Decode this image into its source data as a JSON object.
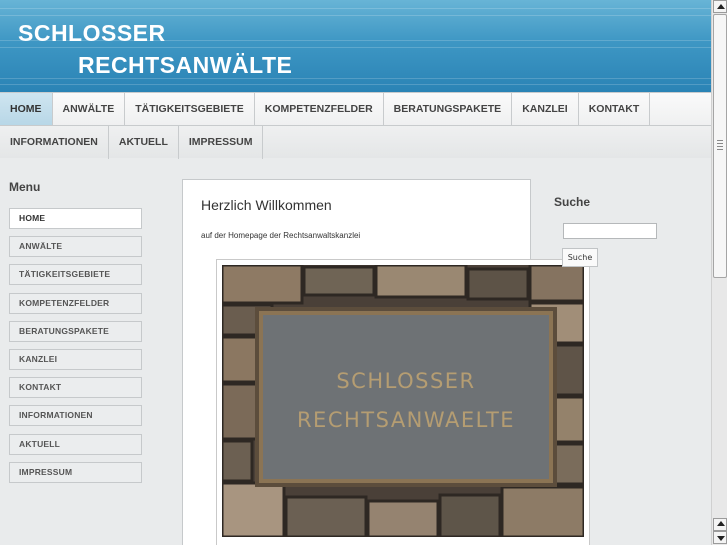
{
  "header": {
    "logo_line1": "SCHLOSSER",
    "logo_line2": "RECHTSANWÄLTE"
  },
  "nav": {
    "row1": [
      {
        "label": "HOME",
        "active": true
      },
      {
        "label": "ANWÄLTE"
      },
      {
        "label": "TÄTIGKEITSGEBIETE"
      },
      {
        "label": "KOMPETENZFELDER"
      },
      {
        "label": "BERATUNGSPAKETE"
      },
      {
        "label": "KANZLEI"
      },
      {
        "label": "KONTAKT"
      }
    ],
    "row2": [
      {
        "label": "INFORMATIONEN"
      },
      {
        "label": "AKTUELL"
      },
      {
        "label": "IMPRESSUM"
      }
    ]
  },
  "sidebar": {
    "title": "Menu",
    "items": [
      {
        "label": "HOME",
        "active": true
      },
      {
        "label": "ANWÄLTE"
      },
      {
        "label": "TÄTIGKEITSGEBIETE"
      },
      {
        "label": "KOMPETENZFELDER"
      },
      {
        "label": "BERATUNGSPAKETE"
      },
      {
        "label": "KANZLEI"
      },
      {
        "label": "KONTAKT"
      },
      {
        "label": "INFORMATIONEN"
      },
      {
        "label": "AKTUELL"
      },
      {
        "label": "IMPRESSUM"
      }
    ]
  },
  "main": {
    "heading": "Herzlich Willkommen",
    "intro": "auf der Homepage der Rechtsanwaltskanzlei",
    "plaque": {
      "line1": "SCHLOSSER",
      "line2": "RECHTSANWAELTE"
    }
  },
  "search": {
    "title": "Suche",
    "input_value": "",
    "button_label": "Suche"
  },
  "colors": {
    "header_blue": "#3e97c4",
    "nav_active": "#c5dfec",
    "plaque_bronze": "#6b5a44"
  },
  "icons": {
    "scroll_up": "arrow-up-icon",
    "scroll_down": "arrow-down-icon"
  }
}
